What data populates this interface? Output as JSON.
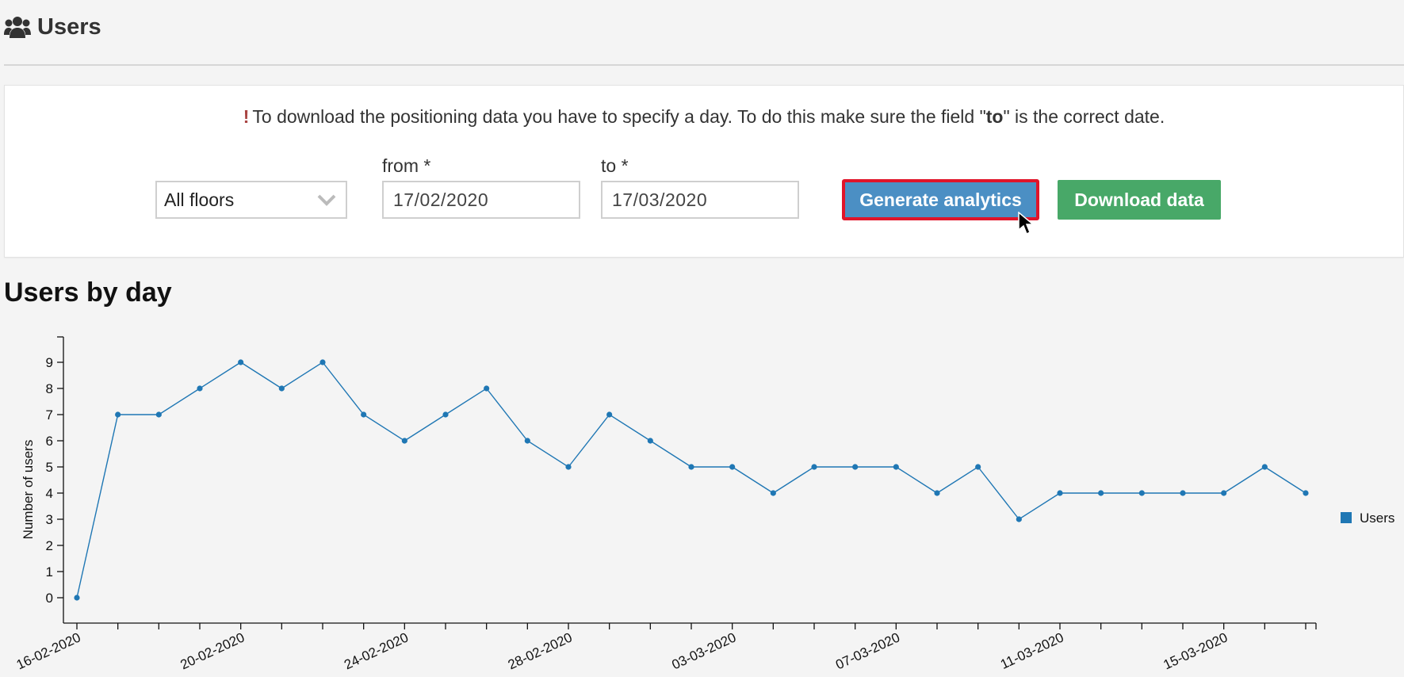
{
  "header": {
    "title": "Users",
    "icon": "users-icon"
  },
  "notice": {
    "before": "To download the positioning data you have to specify a day. To do this make sure the field \"",
    "bold": "to",
    "after": "\" is the correct date."
  },
  "filters": {
    "floor_value": "All floors",
    "from_label": "from *",
    "from_value": "17/02/2020",
    "to_label": "to *",
    "to_value": "17/03/2020"
  },
  "buttons": {
    "generate": "Generate analytics",
    "download": "Download data"
  },
  "colors": {
    "primary": "#4b8fc4",
    "success": "#48a868",
    "highlight": "#e0142a",
    "series": "#1f77b4"
  },
  "section_title": "Users by day",
  "chart_data": {
    "type": "line",
    "ylabel": "Number of users",
    "xlabel": "",
    "ylim": [
      0,
      9
    ],
    "yticks": [
      "0",
      "1",
      "2",
      "3",
      "4",
      "5",
      "6",
      "7",
      "8",
      "9"
    ],
    "x": [
      "16-02-2020",
      "17-02-2020",
      "18-02-2020",
      "19-02-2020",
      "20-02-2020",
      "21-02-2020",
      "22-02-2020",
      "23-02-2020",
      "24-02-2020",
      "25-02-2020",
      "26-02-2020",
      "27-02-2020",
      "28-02-2020",
      "29-02-2020",
      "01-03-2020",
      "02-03-2020",
      "03-03-2020",
      "04-03-2020",
      "05-03-2020",
      "06-03-2020",
      "07-03-2020",
      "08-03-2020",
      "09-03-2020",
      "10-03-2020",
      "11-03-2020",
      "12-03-2020",
      "13-03-2020",
      "14-03-2020",
      "15-03-2020",
      "16-03-2020",
      "17-03-2020"
    ],
    "xtick_labels": [
      "16-02-2020",
      "20-02-2020",
      "24-02-2020",
      "28-02-2020",
      "03-03-2020",
      "07-03-2020",
      "11-03-2020",
      "15-03-2020"
    ],
    "series": [
      {
        "name": "Users",
        "values": [
          0,
          7,
          7,
          8,
          9,
          8,
          9,
          7,
          6,
          7,
          8,
          6,
          5,
          7,
          6,
          5,
          5,
          4,
          5,
          5,
          5,
          4,
          5,
          3,
          4,
          4,
          4,
          4,
          4,
          5,
          4
        ]
      }
    ],
    "legend": "right"
  }
}
